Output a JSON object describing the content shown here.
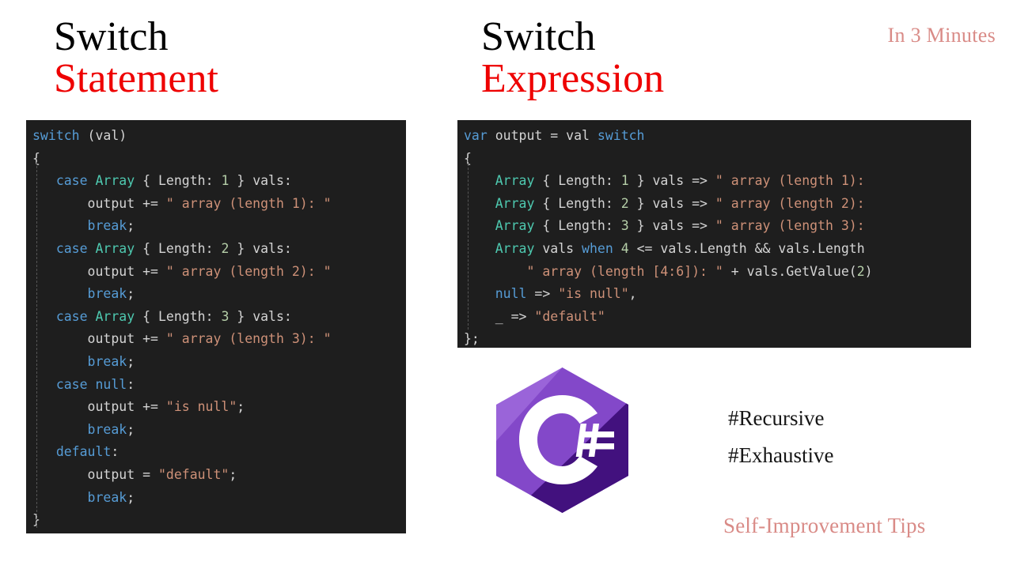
{
  "colors": {
    "background": "#ffffff",
    "heading_primary": "#000000",
    "heading_accent": "#ee0000",
    "rose_accent": "#d98b87",
    "code_background": "#1e1e1e",
    "code_default_text": "#d4d4d4",
    "code_keyword": "#569cd6",
    "code_type": "#4ec9b0",
    "code_string": "#ce9178",
    "code_number": "#b5cea8",
    "logo_light_purple": "#9a64d9",
    "logo_mid_purple": "#7f3fbf",
    "logo_dark_purple": "#42117e"
  },
  "headings": {
    "left": {
      "line1": "Switch",
      "line2": "Statement"
    },
    "right": {
      "line1": "Switch",
      "line2": "Expression"
    }
  },
  "corner_note": "In 3 Minutes",
  "footer_note": "Self-Improvement Tips",
  "hashtags": [
    "#Recursive",
    "#Exhaustive"
  ],
  "logo": {
    "name": "csharp-logo",
    "letter": "C",
    "symbol": "#"
  },
  "code_left": {
    "language": "csharp",
    "lines": [
      [
        {
          "t": "switch",
          "c": "kw"
        },
        {
          "t": " (val)",
          "c": "pln"
        }
      ],
      [
        {
          "t": "{",
          "c": "brc"
        }
      ],
      [
        {
          "t": "   ",
          "c": "pln"
        },
        {
          "t": "case",
          "c": "kw"
        },
        {
          "t": " ",
          "c": "pln"
        },
        {
          "t": "Array",
          "c": "typ"
        },
        {
          "t": " { Length: ",
          "c": "pln"
        },
        {
          "t": "1",
          "c": "num"
        },
        {
          "t": " } vals:",
          "c": "pln"
        }
      ],
      [
        {
          "t": "       output += ",
          "c": "pln"
        },
        {
          "t": "\" array (length 1): \"",
          "c": "str"
        }
      ],
      [
        {
          "t": "       ",
          "c": "pln"
        },
        {
          "t": "break",
          "c": "kw"
        },
        {
          "t": ";",
          "c": "pln"
        }
      ],
      [
        {
          "t": "   ",
          "c": "pln"
        },
        {
          "t": "case",
          "c": "kw"
        },
        {
          "t": " ",
          "c": "pln"
        },
        {
          "t": "Array",
          "c": "typ"
        },
        {
          "t": " { Length: ",
          "c": "pln"
        },
        {
          "t": "2",
          "c": "num"
        },
        {
          "t": " } vals:",
          "c": "pln"
        }
      ],
      [
        {
          "t": "       output += ",
          "c": "pln"
        },
        {
          "t": "\" array (length 2): \"",
          "c": "str"
        }
      ],
      [
        {
          "t": "       ",
          "c": "pln"
        },
        {
          "t": "break",
          "c": "kw"
        },
        {
          "t": ";",
          "c": "pln"
        }
      ],
      [
        {
          "t": "   ",
          "c": "pln"
        },
        {
          "t": "case",
          "c": "kw"
        },
        {
          "t": " ",
          "c": "pln"
        },
        {
          "t": "Array",
          "c": "typ"
        },
        {
          "t": " { Length: ",
          "c": "pln"
        },
        {
          "t": "3",
          "c": "num"
        },
        {
          "t": " } vals:",
          "c": "pln"
        }
      ],
      [
        {
          "t": "       output += ",
          "c": "pln"
        },
        {
          "t": "\" array (length 3): \"",
          "c": "str"
        }
      ],
      [
        {
          "t": "       ",
          "c": "pln"
        },
        {
          "t": "break",
          "c": "kw"
        },
        {
          "t": ";",
          "c": "pln"
        }
      ],
      [
        {
          "t": "   ",
          "c": "pln"
        },
        {
          "t": "case",
          "c": "kw"
        },
        {
          "t": " ",
          "c": "pln"
        },
        {
          "t": "null",
          "c": "kw"
        },
        {
          "t": ":",
          "c": "pln"
        }
      ],
      [
        {
          "t": "       output += ",
          "c": "pln"
        },
        {
          "t": "\"is null\"",
          "c": "str"
        },
        {
          "t": ";",
          "c": "pln"
        }
      ],
      [
        {
          "t": "       ",
          "c": "pln"
        },
        {
          "t": "break",
          "c": "kw"
        },
        {
          "t": ";",
          "c": "pln"
        }
      ],
      [
        {
          "t": "   ",
          "c": "pln"
        },
        {
          "t": "default",
          "c": "kw"
        },
        {
          "t": ":",
          "c": "pln"
        }
      ],
      [
        {
          "t": "       output = ",
          "c": "pln"
        },
        {
          "t": "\"default\"",
          "c": "str"
        },
        {
          "t": ";",
          "c": "pln"
        }
      ],
      [
        {
          "t": "       ",
          "c": "pln"
        },
        {
          "t": "break",
          "c": "kw"
        },
        {
          "t": ";",
          "c": "pln"
        }
      ],
      [
        {
          "t": "}",
          "c": "brc"
        }
      ]
    ]
  },
  "code_right": {
    "language": "csharp",
    "lines": [
      [
        {
          "t": "var",
          "c": "kw"
        },
        {
          "t": " output = val ",
          "c": "pln"
        },
        {
          "t": "switch",
          "c": "kw"
        }
      ],
      [
        {
          "t": "{",
          "c": "brc"
        }
      ],
      [
        {
          "t": "    ",
          "c": "pln"
        },
        {
          "t": "Array",
          "c": "typ"
        },
        {
          "t": " { Length: ",
          "c": "pln"
        },
        {
          "t": "1",
          "c": "num"
        },
        {
          "t": " } vals => ",
          "c": "pln"
        },
        {
          "t": "\" array (length 1):",
          "c": "str"
        }
      ],
      [
        {
          "t": "    ",
          "c": "pln"
        },
        {
          "t": "Array",
          "c": "typ"
        },
        {
          "t": " { Length: ",
          "c": "pln"
        },
        {
          "t": "2",
          "c": "num"
        },
        {
          "t": " } vals => ",
          "c": "pln"
        },
        {
          "t": "\" array (length 2):",
          "c": "str"
        }
      ],
      [
        {
          "t": "    ",
          "c": "pln"
        },
        {
          "t": "Array",
          "c": "typ"
        },
        {
          "t": " { Length: ",
          "c": "pln"
        },
        {
          "t": "3",
          "c": "num"
        },
        {
          "t": " } vals => ",
          "c": "pln"
        },
        {
          "t": "\" array (length 3):",
          "c": "str"
        }
      ],
      [
        {
          "t": "    ",
          "c": "pln"
        },
        {
          "t": "Array",
          "c": "typ"
        },
        {
          "t": " vals ",
          "c": "pln"
        },
        {
          "t": "when",
          "c": "kw"
        },
        {
          "t": " ",
          "c": "pln"
        },
        {
          "t": "4",
          "c": "num"
        },
        {
          "t": " <= vals.Length && vals.Length",
          "c": "pln"
        }
      ],
      [
        {
          "t": "        ",
          "c": "pln"
        },
        {
          "t": "\" array (length [4:6]): \"",
          "c": "str"
        },
        {
          "t": " + vals.GetValue(",
          "c": "pln"
        },
        {
          "t": "2",
          "c": "num"
        },
        {
          "t": ")",
          "c": "pln"
        }
      ],
      [
        {
          "t": "    ",
          "c": "pln"
        },
        {
          "t": "null",
          "c": "kw"
        },
        {
          "t": " => ",
          "c": "pln"
        },
        {
          "t": "\"is null\"",
          "c": "str"
        },
        {
          "t": ",",
          "c": "pln"
        }
      ],
      [
        {
          "t": "    _ => ",
          "c": "pln"
        },
        {
          "t": "\"default\"",
          "c": "str"
        }
      ],
      [
        {
          "t": "};",
          "c": "brc"
        }
      ]
    ]
  }
}
